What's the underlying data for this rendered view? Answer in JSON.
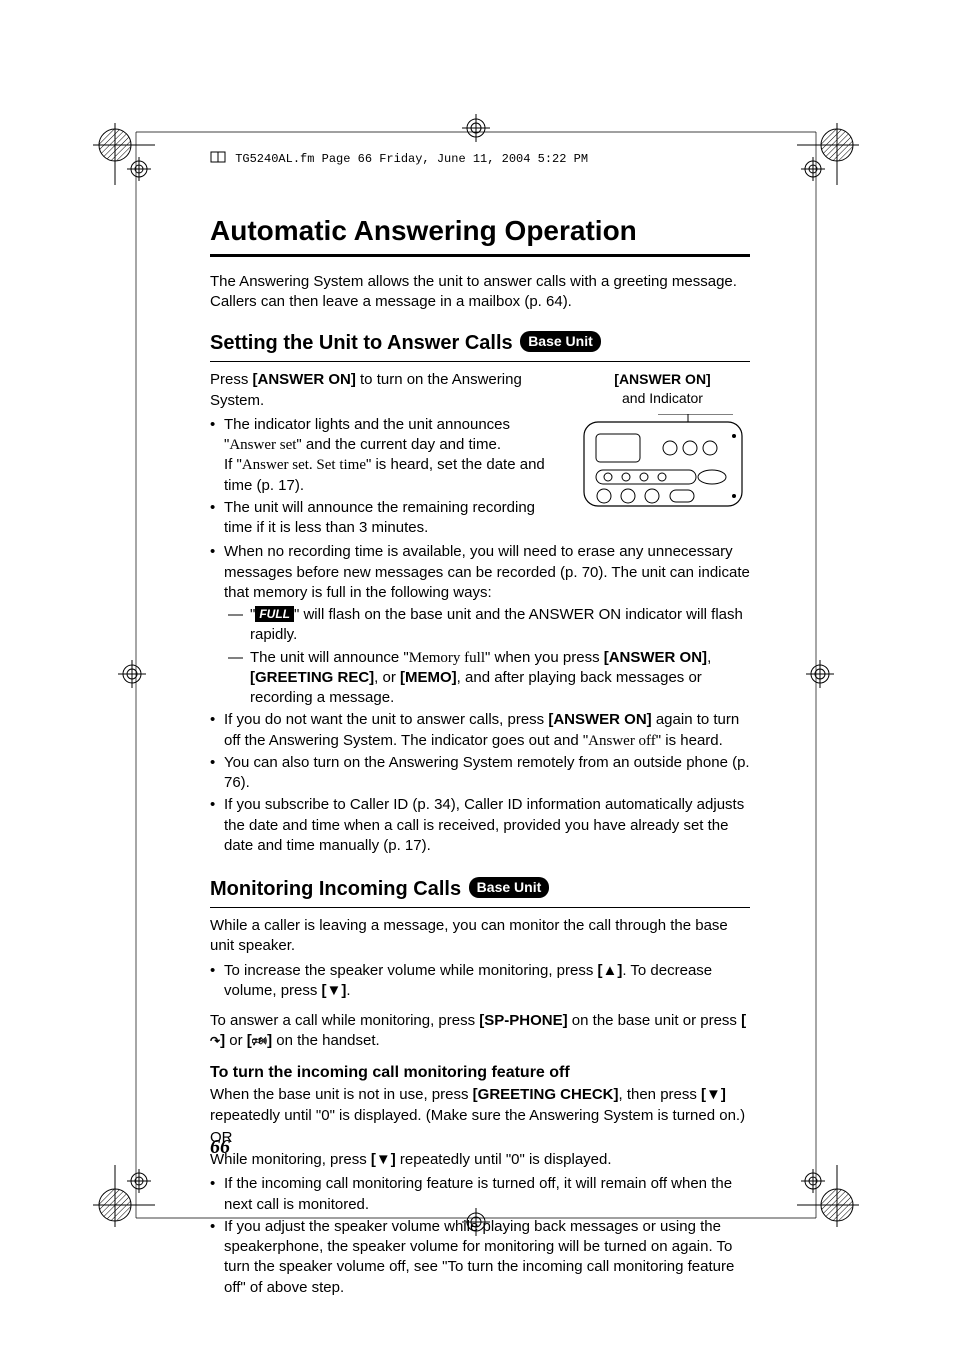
{
  "header_line": "TG5240AL.fm  Page 66  Friday, June 11, 2004  5:22 PM",
  "main_title": "Automatic Answering Operation",
  "intro": "The Answering System allows the unit to answer calls with a greeting message. Callers can then leave a message in a mailbox (p. 64).",
  "section1": {
    "title": "Setting the Unit to Answer Calls",
    "badge": "Base Unit",
    "press_pre": "Press ",
    "press_key": "[ANSWER ON]",
    "press_post": " to turn on the Answering System.",
    "callout_key": "[ANSWER ON]",
    "callout_sub": "and Indicator",
    "b1_a": "The indicator lights and the unit announces \"",
    "b1_b_serif": "Answer set",
    "b1_c": "\" and the current day and time.",
    "b1_if_a": "If \"",
    "b1_if_b_serif": "Answer set. Set time",
    "b1_if_c": "\" is heard, set the date and time (p. 17).",
    "b2": "The unit will announce the remaining recording time if it is less than 3 minutes.",
    "b3": "When no recording time is available, you will need to erase any unnecessary messages before new messages can be recorded (p. 70). The unit can indicate that memory is full in the following ways:",
    "d1_a": "\"",
    "d1_full": "FULL",
    "d1_b": "\" will flash on the base unit and the ANSWER ON indicator will flash rapidly.",
    "d2_a": "The unit will announce \"",
    "d2_serif": "Memory full",
    "d2_b": "\" when you press ",
    "d2_k1": "[ANSWER ON]",
    "d2_c": ", ",
    "d2_k2": "[GREETING REC]",
    "d2_d": ", or ",
    "d2_k3": "[MEMO]",
    "d2_e": ", and after playing back messages or recording a message.",
    "b4_a": "If you do not want the unit to answer calls, press ",
    "b4_k": "[ANSWER ON]",
    "b4_b": " again to turn off the Answering System. The indicator goes out and \"",
    "b4_serif": "Answer off",
    "b4_c": "\" is heard.",
    "b5": "You can also turn on the Answering System remotely from an outside phone (p. 76).",
    "b6": "If you subscribe to Caller ID (p. 34), Caller ID information automatically adjusts the date and time when a call is received, provided you have already set the date and time manually (p. 17)."
  },
  "section2": {
    "title": "Monitoring Incoming Calls",
    "badge": "Base Unit",
    "intro": "While a caller is leaving a message, you can monitor the call through the base unit speaker.",
    "b1_a": "To increase the speaker volume while monitoring, press ",
    "b1_k1": "[▲]",
    "b1_b": ". To decrease volume, press ",
    "b1_k2": "[▼]",
    "b1_c": ".",
    "p2_a": "To answer a call while monitoring, press ",
    "p2_k1": "[SP-PHONE]",
    "p2_b": " on the base unit or press ",
    "p2_k2": "[",
    "p2_k2_sym": "↷",
    "p2_k2_end": "]",
    "p2_c": " or ",
    "p2_k3": "[",
    "p2_k3_sym": "🕬",
    "p2_k3_end": "]",
    "p2_d": " on the handset.",
    "sub_head": "To turn the incoming call monitoring feature off",
    "p3_a": "When the base unit is not in use, press ",
    "p3_k1": "[GREETING CHECK]",
    "p3_b": ", then press ",
    "p3_k2": "[▼]",
    "p3_c": " repeatedly until \"0\" is displayed. (Make sure the Answering System is turned on.)",
    "p3_or": "OR",
    "p4_a": "While monitoring, press ",
    "p4_k": "[▼]",
    "p4_b": " repeatedly until \"0\" is displayed.",
    "b2": "If the incoming call monitoring feature is turned off, it will remain off when the next call is monitored.",
    "b3": "If you adjust the speaker volume while playing back messages or using the speakerphone, the speaker volume for monitoring will be turned on again. To turn the speaker volume off, see \"To turn the incoming call monitoring feature off\" of above step."
  },
  "page_number": "66"
}
